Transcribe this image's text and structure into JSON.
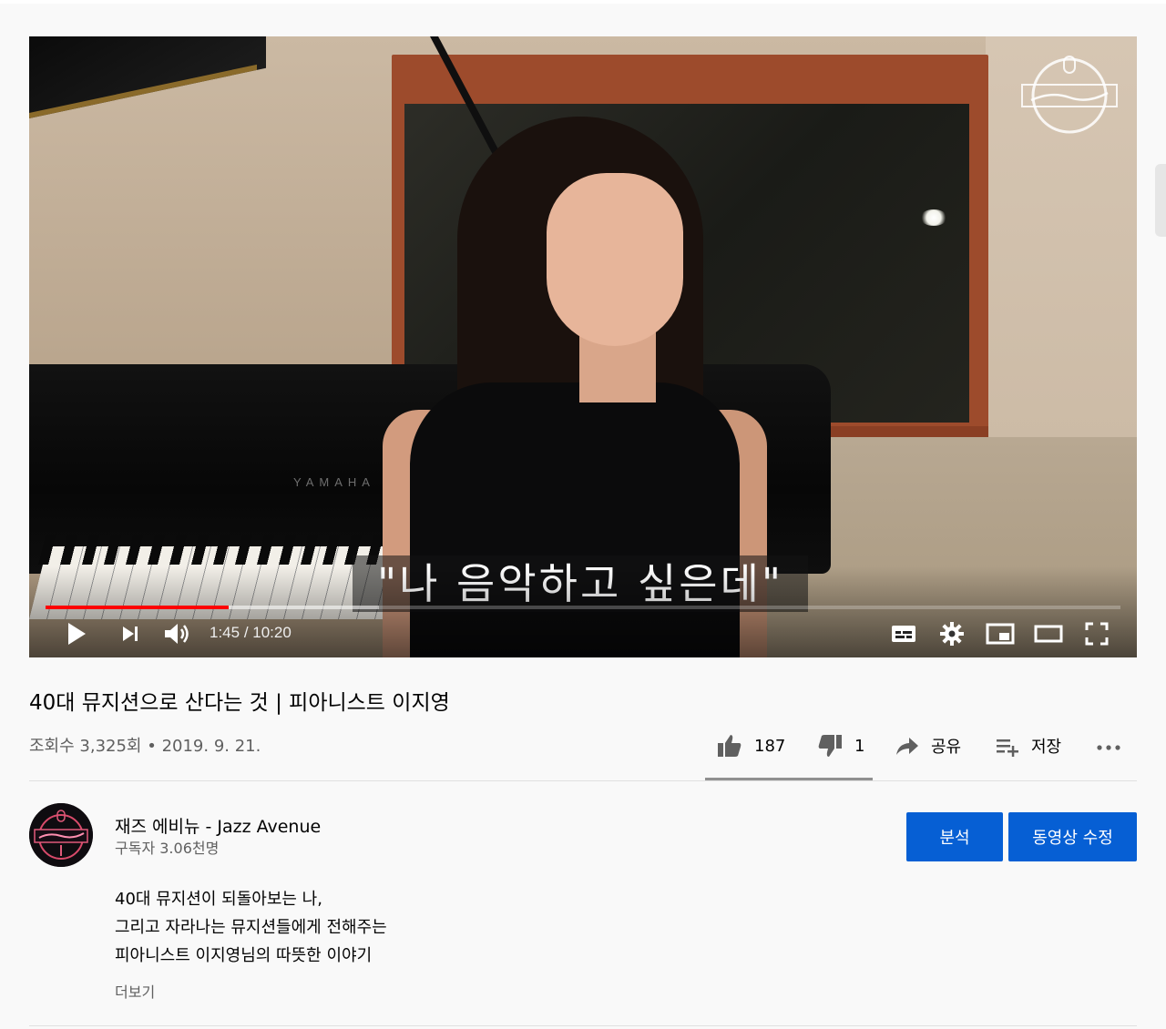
{
  "player": {
    "subtitle": "\"나 음악하고 싶은데\"",
    "piano_brand": "YAMAHA",
    "time_current": "1:45",
    "time_separator": " / ",
    "time_total": "10:20",
    "progress_played_fraction": 0.17,
    "progress_buffered_fraction": 0.31,
    "controls": [
      "play-icon",
      "next-icon",
      "volume-icon",
      "subtitles-icon",
      "settings-icon",
      "miniplayer-icon",
      "theater-icon",
      "fullscreen-icon"
    ],
    "accent_color": "#ff0000"
  },
  "video": {
    "title": "40대 뮤지션으로 산다는 것 | 피아니스트 이지영",
    "views": "조회수 3,325회",
    "date": "2019. 9. 21.",
    "separator": " • "
  },
  "actions": {
    "like_count": "187",
    "dislike_count": "1",
    "share_label": "공유",
    "save_label": "저장"
  },
  "channel": {
    "name": "재즈 에비뉴 - Jazz Avenue",
    "subscribers": "구독자 3.06천명"
  },
  "buttons": {
    "analytics_label": "분석",
    "edit_label": "동영상 수정",
    "color": "#065fd4"
  },
  "description": {
    "lines": [
      "40대 뮤지션이 되돌아보는 나,",
      "그리고 자라나는 뮤지션들에게 전해주는",
      "피아니스트 이지영님의 따뜻한 이야기"
    ],
    "more_label": "더보기"
  }
}
